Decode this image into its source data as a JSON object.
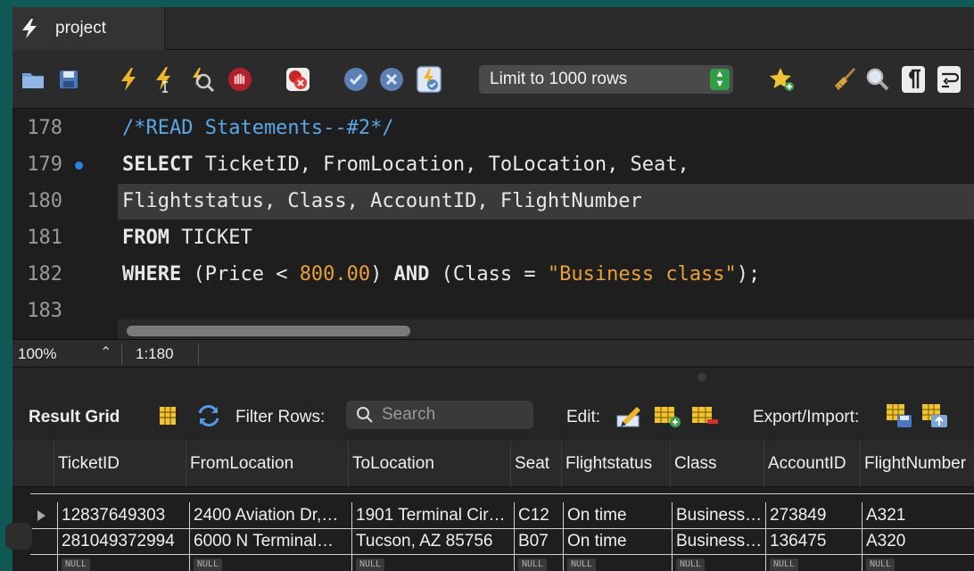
{
  "tab": {
    "title": "project"
  },
  "toolbar": {
    "limit_label": "Limit to 1000 rows"
  },
  "editor": {
    "lines": [
      {
        "number": "178"
      },
      {
        "number": "179"
      },
      {
        "number": "180"
      },
      {
        "number": "181"
      },
      {
        "number": "182"
      },
      {
        "number": "183"
      }
    ],
    "code": {
      "l178_comment": "/*READ Statements--#2*/",
      "l179_kw": "SELECT",
      "l179_rest": " TicketID, FromLocation, ToLocation, Seat,",
      "l180": "Flightstatus, Class, AccountID, FlightNumber",
      "l181_kw": "FROM",
      "l181_rest": " TICKET",
      "l182_kw": "WHERE",
      "l182_a": " (Price < ",
      "l182_num": "800.00",
      "l182_b": ") ",
      "l182_and": "AND",
      "l182_c": " (Class = ",
      "l182_str": "\"Business class\"",
      "l182_d": ");"
    }
  },
  "status": {
    "zoom": "100%",
    "cursor": "1:180"
  },
  "result": {
    "title": "Result Grid",
    "filter_label": "Filter Rows:",
    "search_placeholder": "Search",
    "edit_label": "Edit:",
    "export_label": "Export/Import:"
  },
  "grid": {
    "columns": [
      "TicketID",
      "FromLocation",
      "ToLocation",
      "Seat",
      "Flightstatus",
      "Class",
      "AccountID",
      "FlightNumber"
    ],
    "rows": [
      [
        "12837649303",
        "2400 Aviation Dr,…",
        "1901 Terminal Cir…",
        "C12",
        "On time",
        "Business…",
        "273849",
        "A321"
      ],
      [
        "281049372994",
        "6000 N Terminal…",
        "Tucson, AZ 85756",
        "B07",
        "On time",
        "Business…",
        "136475",
        "A320"
      ],
      [
        "NULL",
        "NULL",
        "NULL",
        "NULL",
        "NULL",
        "NULL",
        "NULL",
        "NULL"
      ]
    ]
  }
}
